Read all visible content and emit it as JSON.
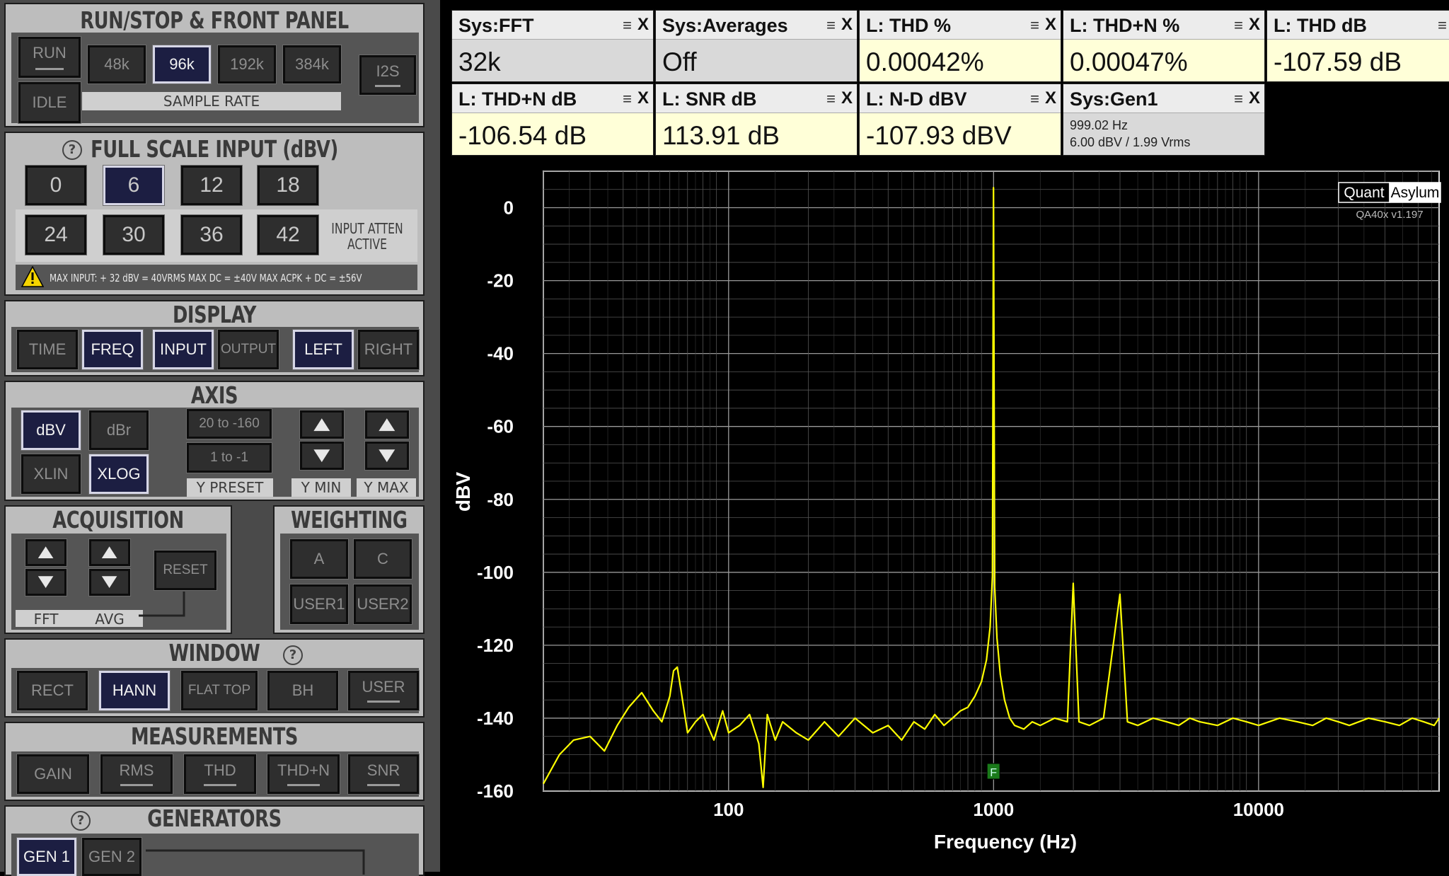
{
  "run_stop": {
    "title": "RUN/STOP & FRONT PANEL",
    "run_label": "RUN",
    "idle_label": "IDLE",
    "sample_rates": [
      "48k",
      "96k",
      "192k",
      "384k"
    ],
    "selected_rate": "96k",
    "sample_rate_label": "SAMPLE RATE",
    "i2s_label": "I2S"
  },
  "full_scale": {
    "title": "FULL SCALE INPUT (dBV)",
    "help_label": "?",
    "levels": [
      "0",
      "6",
      "12",
      "18",
      "24",
      "30",
      "36",
      "42"
    ],
    "selected_level": "6",
    "atten_label_line1": "INPUT ATTEN",
    "atten_label_line2": "ACTIVE",
    "warning_text": "MAX INPUT: + 32 dBV = 40VRMS    MAX DC = ±40V    MAX ACPK + DC = ±56V"
  },
  "display": {
    "title": "DISPLAY",
    "buttons": [
      "TIME",
      "FREQ",
      "INPUT",
      "OUTPUT",
      "LEFT",
      "RIGHT"
    ],
    "active": [
      "FREQ",
      "INPUT",
      "LEFT"
    ]
  },
  "axis": {
    "title": "AXIS",
    "dbv_label": "dBV",
    "dbr_label": "dBr",
    "xlin_label": "XLIN",
    "xlog_label": "XLOG",
    "preset1_label": "20 to -160",
    "preset2_label": "1 to -1",
    "y_preset_label": "Y PRESET",
    "y_min_label": "Y MIN",
    "y_max_label": "Y MAX"
  },
  "acquisition": {
    "title": "ACQUISITION",
    "reset_label": "RESET",
    "fft_label": "FFT",
    "avg_label": "AVG"
  },
  "weighting": {
    "title": "WEIGHTING",
    "buttons": [
      "A",
      "C",
      "USER1",
      "USER2"
    ]
  },
  "window": {
    "title": "WINDOW",
    "help_label": "?",
    "buttons": [
      "RECT",
      "HANN",
      "FLAT TOP",
      "BH",
      "USER"
    ],
    "active": "HANN"
  },
  "measurements": {
    "title": "MEASUREMENTS",
    "buttons": [
      "GAIN",
      "RMS",
      "THD",
      "THD+N",
      "SNR"
    ]
  },
  "generators": {
    "title": "GENERATORS",
    "help_label": "?",
    "gen1_label": "GEN 1",
    "gen2_label": "GEN 2"
  },
  "tiles": [
    {
      "title": "Sys:FFT",
      "value": "32k",
      "kind": "sys"
    },
    {
      "title": "Sys:Averages",
      "value": "Off",
      "kind": "sys"
    },
    {
      "title": "L: THD %",
      "value": "0.00042%",
      "kind": "meas"
    },
    {
      "title": "L: THD+N %",
      "value": "0.00047%",
      "kind": "meas"
    },
    {
      "title": "L: THD dB",
      "value": "-107.59 dB",
      "kind": "meas"
    },
    {
      "title": "L: THD+N dB",
      "value": "-106.54 dB",
      "kind": "meas"
    },
    {
      "title": "L: SNR dB",
      "value": "113.91 dB",
      "kind": "meas"
    },
    {
      "title": "L: N-D dBV",
      "value": "-107.93 dBV",
      "kind": "meas"
    },
    {
      "title": "Sys:Gen1",
      "value": "",
      "kind": "sys",
      "sub1": "999.02 Hz",
      "sub2": "6.00 dBV  / 1.99 Vrms"
    }
  ],
  "tile_menu_icon": "≡",
  "tile_close_icon": "X",
  "brand": {
    "quant": "Quant",
    "asylum": "Asylum",
    "version": "QA40x v1.197"
  },
  "colors": {
    "trace": "#ffff00",
    "marker": "#1a7a1a",
    "active_button": "#1c1e42"
  },
  "chart_data": {
    "type": "line",
    "xscale": "log",
    "xlabel": "Frequency (Hz)",
    "ylabel": "dBV",
    "xlim": [
      20,
      48000
    ],
    "ylim": [
      -160,
      10
    ],
    "x_ticks": [
      100,
      1000,
      10000
    ],
    "x_tick_labels": [
      "100",
      "1000",
      "10000"
    ],
    "y_ticks": [
      0,
      -20,
      -40,
      -60,
      -80,
      -100,
      -120,
      -140,
      -160
    ],
    "grid": true,
    "series": [
      {
        "color": "#ffff00",
        "x": [
          20,
          23,
          26,
          30,
          34,
          38,
          42,
          47,
          52,
          56,
          60,
          62,
          64,
          66,
          70,
          75,
          80,
          88,
          95,
          100,
          110,
          120,
          130,
          135,
          140,
          150,
          160,
          180,
          200,
          230,
          260,
          300,
          350,
          400,
          450,
          500,
          550,
          600,
          650,
          700,
          750,
          800,
          850,
          900,
          940,
          970,
          990,
          999,
          1010,
          1030,
          1060,
          1100,
          1150,
          1200,
          1300,
          1400,
          1500,
          1700,
          1900,
          1998,
          2100,
          2300,
          2600,
          2997,
          3200,
          3500,
          4000,
          4500,
          5000,
          5500,
          6000,
          7000,
          8000,
          9000,
          10000,
          12000,
          14000,
          16000,
          18000,
          20000,
          22000,
          26000,
          30000,
          34000,
          38000,
          42000,
          46000,
          48000
        ],
        "y": [
          -158,
          -150,
          -146,
          -145,
          -149,
          -142,
          -137,
          -133,
          -138,
          -141,
          -134,
          -127,
          -126,
          -132,
          -144,
          -141,
          -139,
          -146,
          -138,
          -144,
          -142,
          -139,
          -147,
          -159,
          -139,
          -146,
          -141,
          -144,
          -146,
          -141,
          -145,
          -140,
          -144,
          -142,
          -146,
          -141,
          -143,
          -139,
          -142,
          -140,
          -138,
          -137,
          -134,
          -130,
          -124,
          -115,
          -101,
          5.5,
          -104,
          -118,
          -128,
          -135,
          -140,
          -142,
          -143,
          -141,
          -142,
          -140,
          -141,
          -103,
          -141,
          -142,
          -140,
          -106,
          -141,
          -142,
          -140,
          -141,
          -142,
          -140,
          -141,
          -142,
          -140,
          -141,
          -142,
          -140,
          -141,
          -142,
          -140,
          -141,
          -142,
          -140,
          -141,
          -142,
          -140,
          -141,
          -142,
          -140
        ]
      }
    ],
    "marker_label": "F",
    "marker_x": 999
  }
}
